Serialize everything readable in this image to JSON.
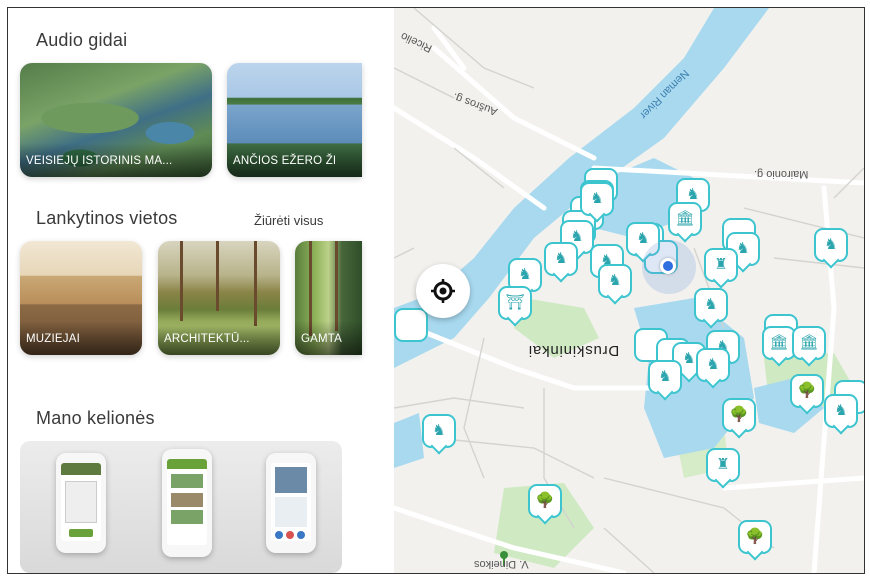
{
  "audio_guides": {
    "title": "Audio gidai",
    "cards": [
      {
        "label": "VEISIEJŲ ISTORINIS MA...",
        "icon": "lake-village-photo"
      },
      {
        "label": "ANČIOS EŽERO ŽI",
        "icon": "lake-photo"
      }
    ]
  },
  "places": {
    "title": "Lankytinos vietos",
    "see_all": "Žiūrėti visus",
    "cards": [
      {
        "label": "MUZIEJAI",
        "icon": "museum-photo"
      },
      {
        "label": "ARCHITEKTŪ...",
        "icon": "architecture-photo"
      },
      {
        "label": "GAMTA",
        "icon": "nature-photo"
      }
    ]
  },
  "trips": {
    "title": "Mano kelionės"
  },
  "map": {
    "road_labels": {
      "aukros": "Aušros g.",
      "maironio": "Maironio g.",
      "river": "Neman River",
      "ricelio": "Ricelio",
      "city": "Druskininkai",
      "dineikos": "V. Dineikos"
    },
    "colors": {
      "water": "#a8d9ef",
      "park": "#cfe9c2",
      "pin": "#3cc4cf"
    }
  }
}
